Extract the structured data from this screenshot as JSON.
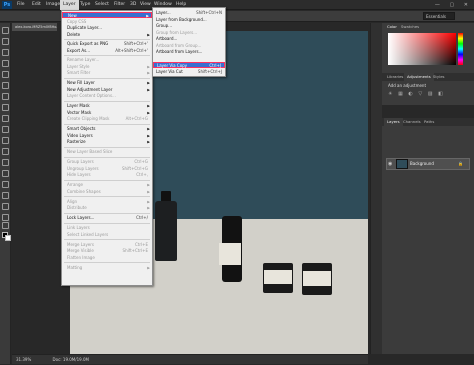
{
  "menubar": {
    "logo": "Ps",
    "items": [
      "File",
      "Edit",
      "Image",
      "Layer",
      "Type",
      "Select",
      "Filter",
      "3D",
      "View",
      "Window",
      "Help"
    ],
    "window_controls": "— ▢ ✕"
  },
  "options": {
    "workspace": "Essentials"
  },
  "document": {
    "tab": "alex-koro-MRZ5m0f8Ho..."
  },
  "status": {
    "zoom": "31.39%",
    "doc": "Doc: 19.0M/19.0M"
  },
  "layer_menu": {
    "new": "New",
    "copy_css": "Copy CSS",
    "duplicate": "Duplicate Layer...",
    "delete": "Delete",
    "quick_export": "Quick Export as PNG",
    "quick_export_sc": "Shift+Ctrl+'",
    "export_as": "Export As...",
    "export_as_sc": "Alt+Shift+Ctrl+'",
    "rename": "Rename Layer...",
    "layer_style": "Layer Style",
    "smart_filter": "Smart Filter",
    "new_fill": "New Fill Layer",
    "new_adjustment": "New Adjustment Layer",
    "content_options": "Layer Content Options...",
    "layer_mask": "Layer Mask",
    "vector_mask": "Vector Mask",
    "clipping_mask": "Create Clipping Mask",
    "clipping_mask_sc": "Alt+Ctrl+G",
    "smart_objects": "Smart Objects",
    "video_layers": "Video Layers",
    "rasterize": "Rasterize",
    "slice": "New Layer Based Slice",
    "group": "Group Layers",
    "group_sc": "Ctrl+G",
    "ungroup": "Ungroup Layers",
    "ungroup_sc": "Shift+Ctrl+G",
    "hide": "Hide Layers",
    "hide_sc": "Ctrl+,",
    "arrange": "Arrange",
    "combine": "Combine Shapes",
    "align": "Align",
    "distribute": "Distribute",
    "lock": "Lock Layers...",
    "lock_sc": "Ctrl+/",
    "link": "Link Layers",
    "select_linked": "Select Linked Layers",
    "merge": "Merge Layers",
    "merge_sc": "Ctrl+E",
    "merge_visible": "Merge Visible",
    "merge_visible_sc": "Shift+Ctrl+E",
    "flatten": "Flatten Image",
    "matting": "Matting"
  },
  "new_submenu": {
    "layer": "Layer...",
    "layer_sc": "Shift+Ctrl+N",
    "from_background": "Layer from Background...",
    "group": "Group...",
    "group_from_layers": "Group from Layers...",
    "artboard": "Artboard...",
    "artboard_from_group": "Artboard from Group...",
    "artboard_from_layers": "Artboard from Layers...",
    "via_copy": "Layer Via Copy",
    "via_copy_sc": "Ctrl+J",
    "via_cut": "Layer Via Cut",
    "via_cut_sc": "Shift+Ctrl+J"
  },
  "panels": {
    "color_tabs": [
      "Color",
      "Swatches"
    ],
    "adj_tabs": [
      "Libraries",
      "Adjustments",
      "Styles"
    ],
    "adj_title": "Add an adjustment",
    "adj_icons": "☀ ▦ ◐ ▽ ▨ ◧",
    "layers_tabs": [
      "Layers",
      "Channels",
      "Paths"
    ],
    "layer_name": "Background",
    "eye": "◉",
    "lock": "🔒"
  }
}
